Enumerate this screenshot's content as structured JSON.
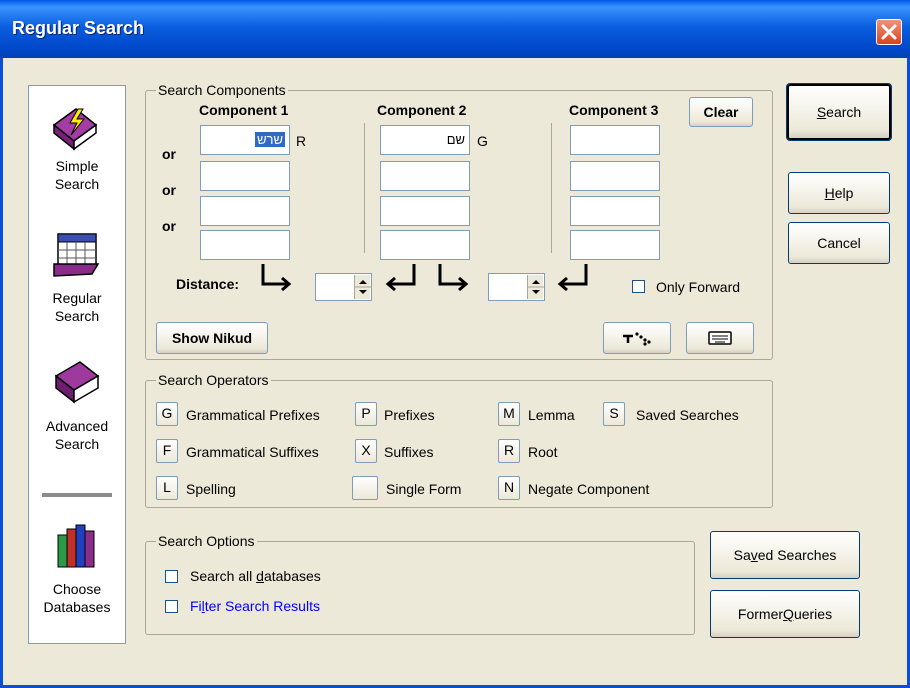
{
  "window": {
    "title": "Regular Search"
  },
  "sidebar": {
    "items": [
      {
        "icon": "lightning-book-icon",
        "line1": "Simple",
        "line2": "Search"
      },
      {
        "icon": "grid-book-icon",
        "line1": "Regular",
        "line2": "Search"
      },
      {
        "icon": "purple-book-icon",
        "line1": "Advanced",
        "line2": "Search"
      },
      {
        "icon": "books-icon",
        "line1": "Choose",
        "line2": "Databases"
      }
    ]
  },
  "components": {
    "legend": "Search Components",
    "headers": [
      "Component 1",
      "Component 2",
      "Component 3"
    ],
    "clear_label": "Clear",
    "or_labels": [
      "or",
      "or",
      "or"
    ],
    "c1_field1_value": "שרש",
    "c1_field1_operator": "R",
    "c2_field1_value": "שם",
    "c2_field1_operator": "G",
    "distance_label": "Distance:",
    "only_forward_label": "Only Forward",
    "show_nikud_label": "Show Nikud"
  },
  "operators": {
    "legend": "Search Operators",
    "items": [
      {
        "key": "G",
        "label": "Grammatical Prefixes"
      },
      {
        "key": "P",
        "label": "Prefixes"
      },
      {
        "key": "M",
        "label": "Lemma"
      },
      {
        "key": "S",
        "label": "Saved Searches"
      },
      {
        "key": "F",
        "label": "Grammatical Suffixes"
      },
      {
        "key": "X",
        "label": "Suffixes"
      },
      {
        "key": "R",
        "label": "Root"
      },
      {
        "key": "L",
        "label": "Spelling"
      },
      {
        "key": "",
        "label": "Single Form"
      },
      {
        "key": "N",
        "label": "Negate Component"
      }
    ]
  },
  "options": {
    "legend": "Search Options",
    "search_all_pre": "Search all ",
    "search_all_u": "d",
    "search_all_post": "atabases",
    "filter_pre": "Fi",
    "filter_u": "l",
    "filter_post": "ter Search Results",
    "filter_color": "#0000ff"
  },
  "buttons": {
    "search_u": "S",
    "search_rest": "earch",
    "help_u": "H",
    "help_rest": "elp",
    "cancel": "Cancel",
    "saved_pre": "Sa",
    "saved_u": "v",
    "saved_post": "ed Searches",
    "former_pre": "Former ",
    "former_u": "Q",
    "former_post": "ueries"
  }
}
